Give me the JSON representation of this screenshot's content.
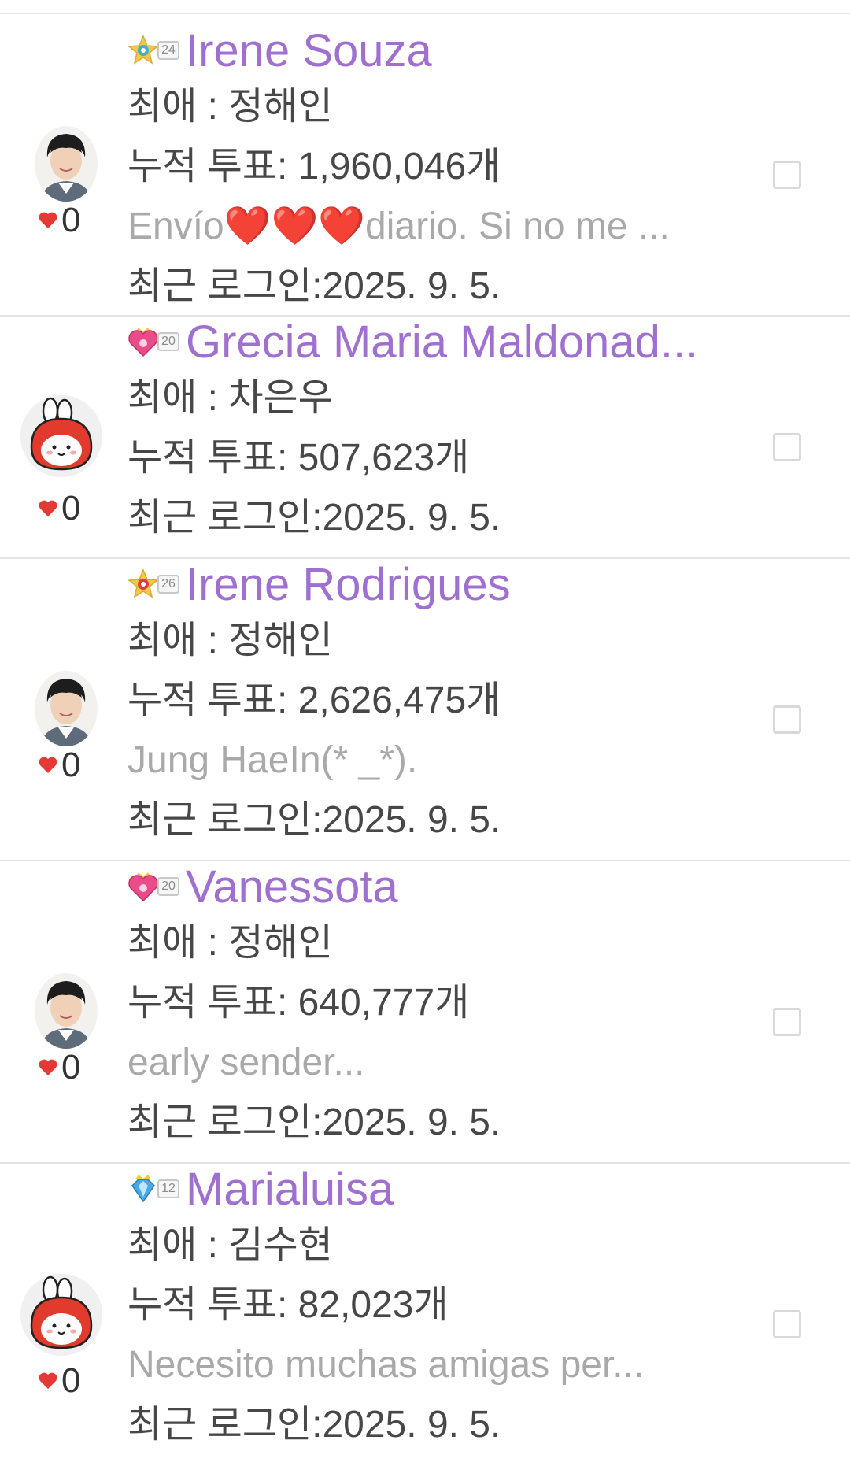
{
  "favorite_prefix": "최애 : ",
  "votes_prefix": "누적 투표: ",
  "votes_suffix": "개",
  "login_prefix": "최근 로그인:",
  "colors": {
    "name": "#a070d0",
    "heart": "#e53935",
    "text": "#474747",
    "message": "#a9a9a9"
  },
  "users": [
    {
      "name": "Irene Souza",
      "badge_level": "24",
      "badge_icon": "star-badge-icon",
      "favorite": "정해인",
      "votes": "1,960,046",
      "message": "Envío❤️❤️❤️diario.  Si no me ...",
      "last_login": "2025. 9. 5.",
      "avatar": "man-photo-avatar",
      "likes": "0"
    },
    {
      "name": "Grecia Maria Maldonad...",
      "badge_level": "20",
      "badge_icon": "heart-crown-badge-icon",
      "favorite": "차은우",
      "votes": "507,623",
      "message": "",
      "last_login": "2025. 9. 5.",
      "avatar": "bunny-avatar",
      "likes": "0"
    },
    {
      "name": "Irene Rodrigues",
      "badge_level": "26",
      "badge_icon": "star-badge-icon",
      "favorite": "정해인",
      "votes": "2,626,475",
      "message": " Jung HaeIn(* _*).",
      "last_login": "2025. 9. 5.",
      "avatar": "man-photo-avatar",
      "likes": "0"
    },
    {
      "name": "Vanessota",
      "badge_level": "20",
      "badge_icon": "heart-crown-badge-icon",
      "favorite": "정해인",
      "votes": "640,777",
      "message": "early sender...",
      "last_login": "2025. 9. 5.",
      "avatar": "man-photo-avatar",
      "likes": "0"
    },
    {
      "name": "Marialuisa",
      "badge_level": "12",
      "badge_icon": "diamond-badge-icon",
      "favorite": "김수현",
      "votes": "82,023",
      "message": "Necesito muchas amigas per...",
      "last_login": "2025. 9. 5.",
      "avatar": "bunny-avatar",
      "likes": "0"
    }
  ]
}
